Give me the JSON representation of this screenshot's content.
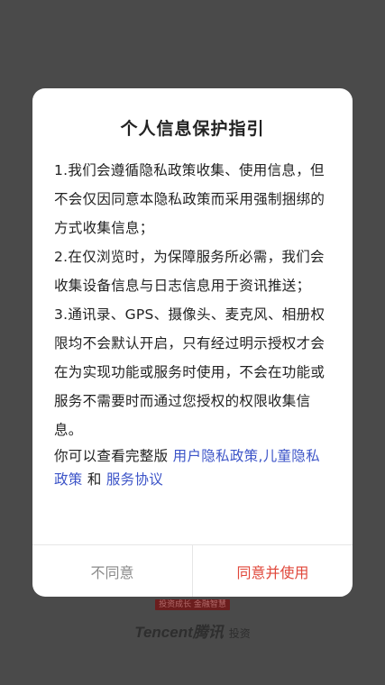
{
  "backdrop": {
    "badge": "投资成长 金融智慧",
    "brand": "Tencent",
    "brand_cn": "腾讯",
    "brand_suffix": "投资"
  },
  "dialog": {
    "title": "个人信息保护指引",
    "paragraphs": [
      "1.我们会遵循隐私政策收集、使用信息，但不会仅因同意本隐私政策而采用强制捆绑的方式收集信息；",
      "2.在仅浏览时，为保障服务所必需，我们会收集设备信息与日志信息用于资讯推送；",
      "3.通讯录、GPS、摄像头、麦克风、相册权限均不会默认开启，只有经过明示授权才会在为实现功能或服务时使用，不会在功能或服务不需要时而通过您授权的权限收集信息。"
    ],
    "links_prefix": "你可以查看完整版 ",
    "link_user_privacy": "用户隐私政策",
    "comma": ",",
    "link_child_privacy": "儿童隐私政策",
    "and_text": " 和 ",
    "link_service": "服务协议",
    "disagree_label": "不同意",
    "agree_label": "同意并使用"
  },
  "colors": {
    "overlay": "#4a4a4a",
    "link": "#3c54c8",
    "agree": "#e0473a",
    "disagree": "#8a8a8a"
  }
}
